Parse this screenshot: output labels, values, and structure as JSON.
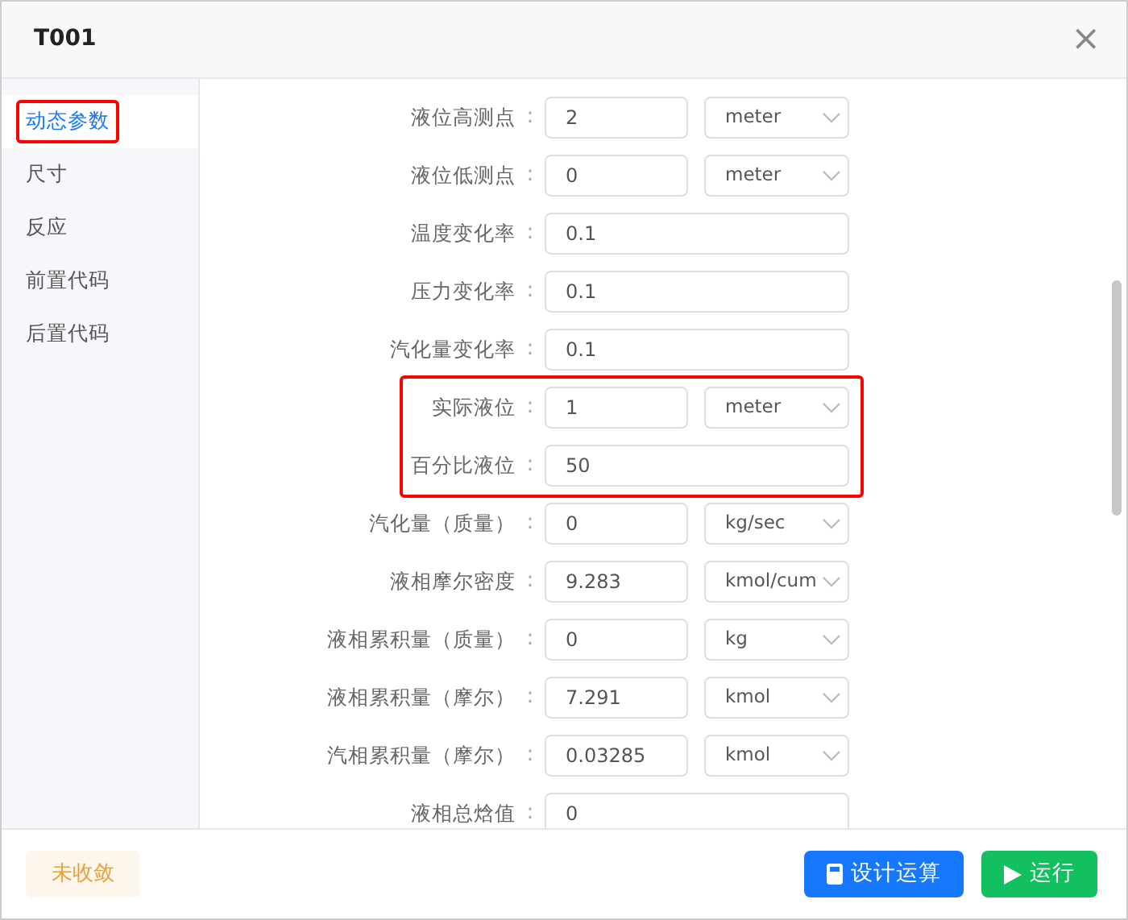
{
  "dialog": {
    "title": "T001",
    "close": "×"
  },
  "sidebar": {
    "items": [
      {
        "label": "动态参数",
        "selected": true,
        "highlighted": true
      },
      {
        "label": "尺寸",
        "selected": false,
        "highlighted": false
      },
      {
        "label": "反应",
        "selected": false,
        "highlighted": false
      },
      {
        "label": "前置代码",
        "selected": false,
        "highlighted": false
      },
      {
        "label": "后置代码",
        "selected": false,
        "highlighted": false
      }
    ]
  },
  "fields": [
    {
      "label": "液位高测点",
      "colon": ":",
      "value": "2",
      "unit": "meter",
      "highlighted": false
    },
    {
      "label": "液位低测点",
      "colon": ":",
      "value": "0",
      "unit": "meter",
      "highlighted": false
    },
    {
      "label": "温度变化率",
      "colon": ":",
      "value": "0.1",
      "highlighted": false
    },
    {
      "label": "压力变化率",
      "colon": ":",
      "value": "0.1",
      "highlighted": false
    },
    {
      "label": "汽化量变化率",
      "colon": ":",
      "value": "0.1",
      "highlighted": false
    },
    {
      "label": "实际液位",
      "colon": ":",
      "value": "1",
      "unit": "meter",
      "highlighted": true
    },
    {
      "label": "百分比液位",
      "colon": ":",
      "value": "50",
      "highlighted": true
    },
    {
      "label": "汽化量（质量）",
      "colon": ":",
      "value": "0",
      "unit": "kg/sec",
      "highlighted": false
    },
    {
      "label": "液相摩尔密度",
      "colon": ":",
      "value": "9.283",
      "unit": "kmol/cum",
      "highlighted": false
    },
    {
      "label": "液相累积量（质量）",
      "colon": ":",
      "value": "0",
      "unit": "kg",
      "highlighted": false
    },
    {
      "label": "液相累积量（摩尔）",
      "colon": ":",
      "value": "7.291",
      "unit": "kmol",
      "highlighted": false
    },
    {
      "label": "汽相累积量（摩尔）",
      "colon": ":",
      "value": "0.03285",
      "unit": "kmol",
      "highlighted": false
    },
    {
      "label": "液相总焓值",
      "colon": ":",
      "value": "0",
      "highlighted": false
    }
  ],
  "footer": {
    "status": "未收敛",
    "buttons": [
      {
        "label": "设计运算",
        "kind": "design"
      },
      {
        "label": "运行",
        "kind": "run"
      }
    ]
  }
}
